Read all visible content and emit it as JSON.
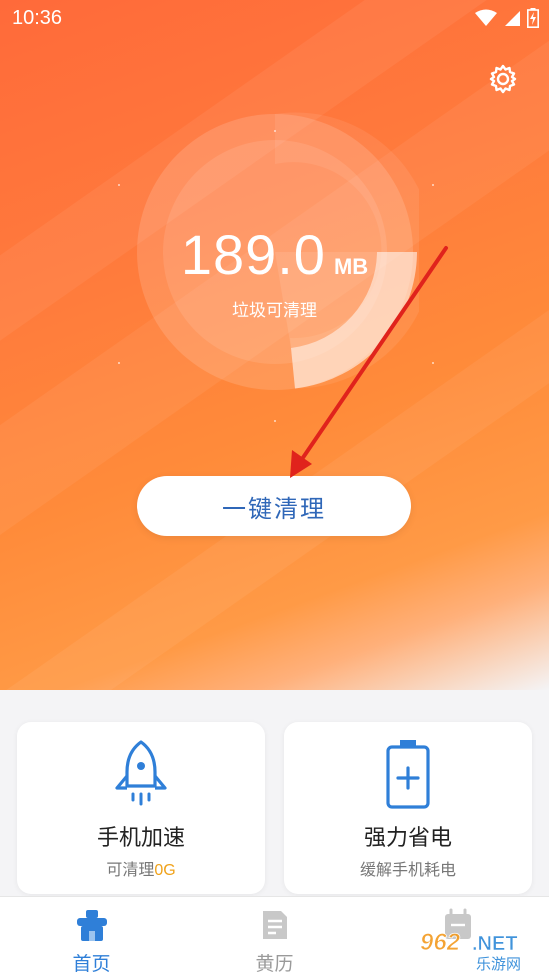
{
  "status_bar": {
    "time": "10:36"
  },
  "hero": {
    "amount": "189.0",
    "unit": "MB",
    "label": "垃圾可清理",
    "clean_button": "一键清理"
  },
  "cards": [
    {
      "title": "手机加速",
      "sub_prefix": "可清理",
      "sub_value": "0G",
      "icon": "rocket-icon"
    },
    {
      "title": "强力省电",
      "sub": "缓解手机耗电",
      "icon": "battery-plus-icon"
    }
  ],
  "tabs": [
    {
      "label": "首页",
      "active": true,
      "icon": "home-icon"
    },
    {
      "label": "黄历",
      "active": false,
      "icon": "almanac-icon"
    },
    {
      "label": "",
      "active": false,
      "icon": "calendar-icon"
    }
  ],
  "watermark": {
    "brand": "962.NET",
    "sub": "乐游网"
  },
  "colors": {
    "accent": "#2f7fd8",
    "hero_top": "#ff6a3a",
    "hero_bottom": "#ff9a46",
    "highlight": "#f0a21a",
    "inactive_tab": "#9a9a9a"
  }
}
